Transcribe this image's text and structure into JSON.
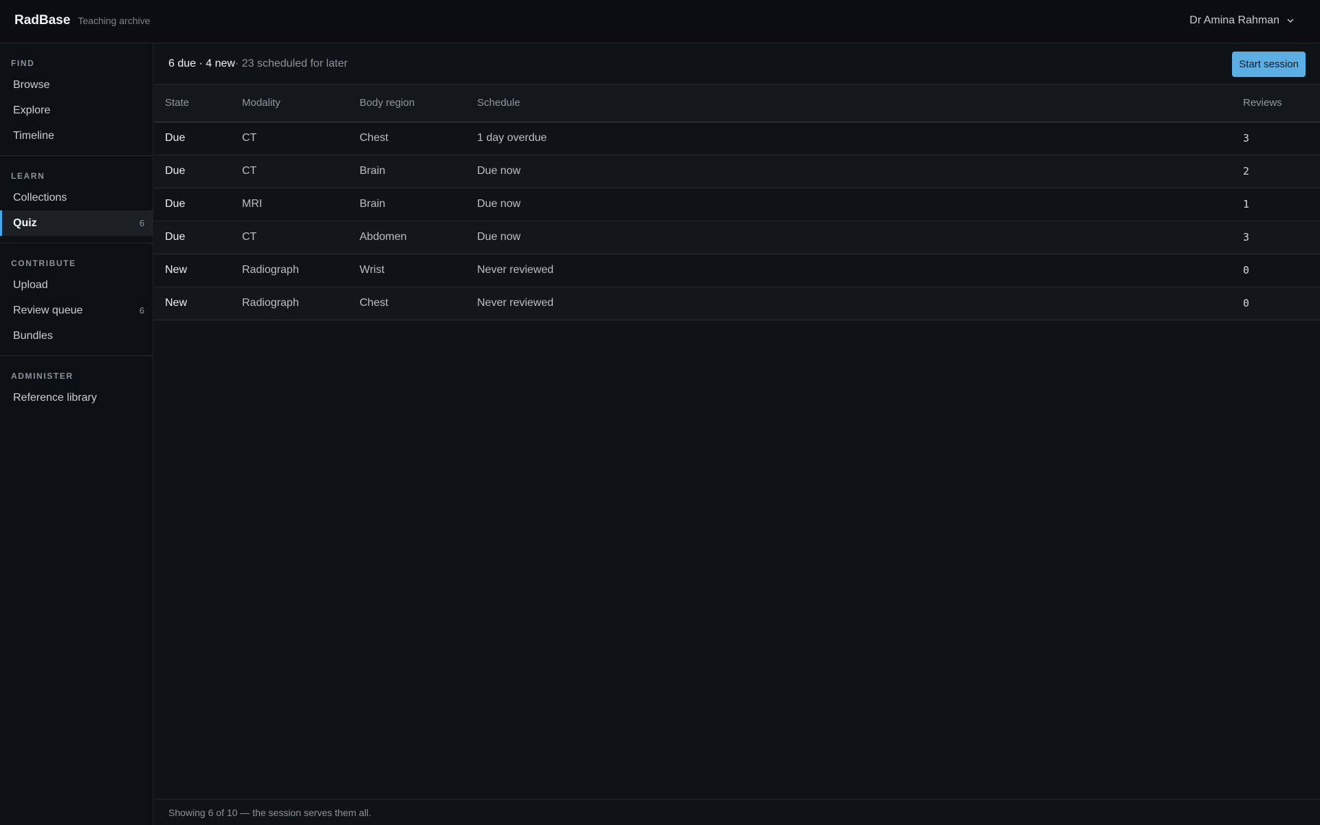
{
  "app": {
    "name": "RadBase",
    "subtitle": "Teaching archive"
  },
  "user": {
    "name": "Dr Amina Rahman",
    "menu_icon": "chevron-down-icon"
  },
  "sidebar": {
    "sections": [
      {
        "heading": "FIND",
        "items": [
          {
            "label": "Browse"
          },
          {
            "label": "Explore"
          },
          {
            "label": "Timeline"
          }
        ]
      },
      {
        "heading": "LEARN",
        "items": [
          {
            "label": "Collections"
          },
          {
            "label": "Quiz",
            "count": "6",
            "active": true
          }
        ]
      },
      {
        "heading": "CONTRIBUTE",
        "items": [
          {
            "label": "Upload"
          },
          {
            "label": "Review queue",
            "count": "6"
          },
          {
            "label": "Bundles"
          }
        ]
      },
      {
        "heading": "ADMINISTER",
        "items": [
          {
            "label": "Reference library"
          }
        ]
      }
    ]
  },
  "summary": {
    "strong_text": "6 due · 4 new",
    "muted_text": " · 23 scheduled for later"
  },
  "actions": {
    "start_session": "Start session"
  },
  "table": {
    "columns": {
      "state": "State",
      "modality": "Modality",
      "body_region": "Body region",
      "schedule": "Schedule",
      "reviews": "Reviews"
    },
    "rows": [
      {
        "state": "Due",
        "modality": "CT",
        "body_region": "Chest",
        "schedule": "1 day overdue",
        "reviews": "3"
      },
      {
        "state": "Due",
        "modality": "CT",
        "body_region": "Brain",
        "schedule": "Due now",
        "reviews": "2"
      },
      {
        "state": "Due",
        "modality": "MRI",
        "body_region": "Brain",
        "schedule": "Due now",
        "reviews": "1"
      },
      {
        "state": "Due",
        "modality": "CT",
        "body_region": "Abdomen",
        "schedule": "Due now",
        "reviews": "3"
      },
      {
        "state": "New",
        "modality": "Radiograph",
        "body_region": "Wrist",
        "schedule": "Never reviewed",
        "reviews": "0"
      },
      {
        "state": "New",
        "modality": "Radiograph",
        "body_region": "Chest",
        "schedule": "Never reviewed",
        "reviews": "0"
      }
    ]
  },
  "footer": {
    "text": "Showing 6 of 10 — the session serves them all."
  },
  "colors": {
    "accent": "#5aaee4",
    "active_bar": "#4aa6e4",
    "background": "#101316"
  }
}
